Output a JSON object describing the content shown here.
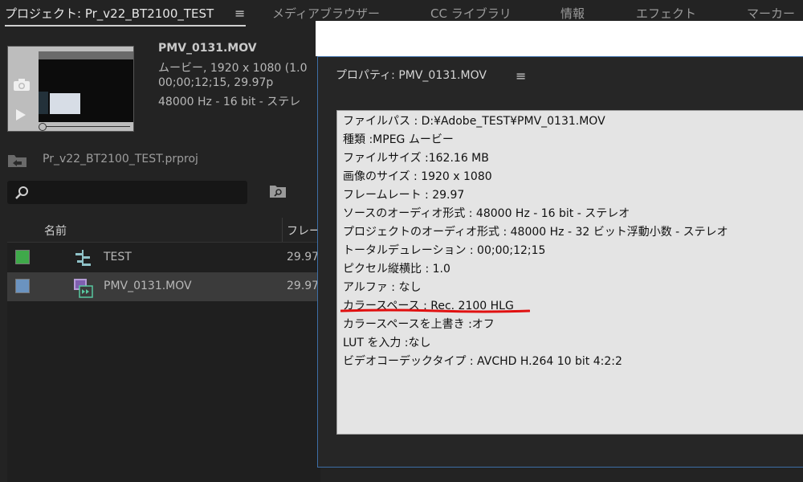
{
  "tabs": [
    {
      "label": "プロジェクト: Pr_v22_BT2100_TEST",
      "active": true
    },
    {
      "label": "メディアブラウザー",
      "active": false
    },
    {
      "label": "CC ライブラリ",
      "active": false
    },
    {
      "label": "情報",
      "active": false
    },
    {
      "label": "エフェクト",
      "active": false
    },
    {
      "label": "マーカー",
      "active": false
    }
  ],
  "preview": {
    "title": "PMV_0131.MOV",
    "line1": "ムービー,  1920 x 1080 (1.0",
    "line2": "00;00;12;15, 29.97p",
    "line3": "48000 Hz - 16 bit - ステレ"
  },
  "bin": {
    "name": "Pr_v22_BT2100_TEST.prproj"
  },
  "search": {
    "value": "",
    "placeholder": ""
  },
  "list": {
    "headers": {
      "name": "名前",
      "frame_rate": "フレー"
    },
    "rows": [
      {
        "name": "TEST",
        "fps": "29.97",
        "color": "#3fa94a",
        "icon": "sequence-icon"
      },
      {
        "name": "PMV_0131.MOV",
        "fps": "29.97",
        "color": "#6b93c0",
        "icon": "video-clip-icon"
      }
    ]
  },
  "properties": {
    "title": "プロパティ: PMV_0131.MOV",
    "lines": [
      "ファイルパス : D:¥Adobe_TEST¥PMV_0131.MOV",
      "種類 :MPEG ムービー",
      "ファイルサイズ :162.16 MB",
      "画像のサイズ : 1920 x 1080",
      "フレームレート : 29.97",
      "ソースのオーディオ形式 : 48000 Hz - 16 bit - ステレオ",
      "プロジェクトのオーディオ形式 : 48000 Hz - 32 ビット浮動小数 - ステレオ",
      "トータルデュレーション : 00;00;12;15",
      "ピクセル縦横比 : 1.0",
      "アルファ : なし",
      "カラースペース : Rec. 2100 HLG",
      "カラースペースを上書き :オフ",
      "LUT を入力 :なし",
      "ビデオコーデックタイプ : AVCHD H.264 10 bit  4:2:2"
    ]
  },
  "colors": {
    "accent_border": "#3d6ea6",
    "highlight_underline": "#e01010"
  }
}
